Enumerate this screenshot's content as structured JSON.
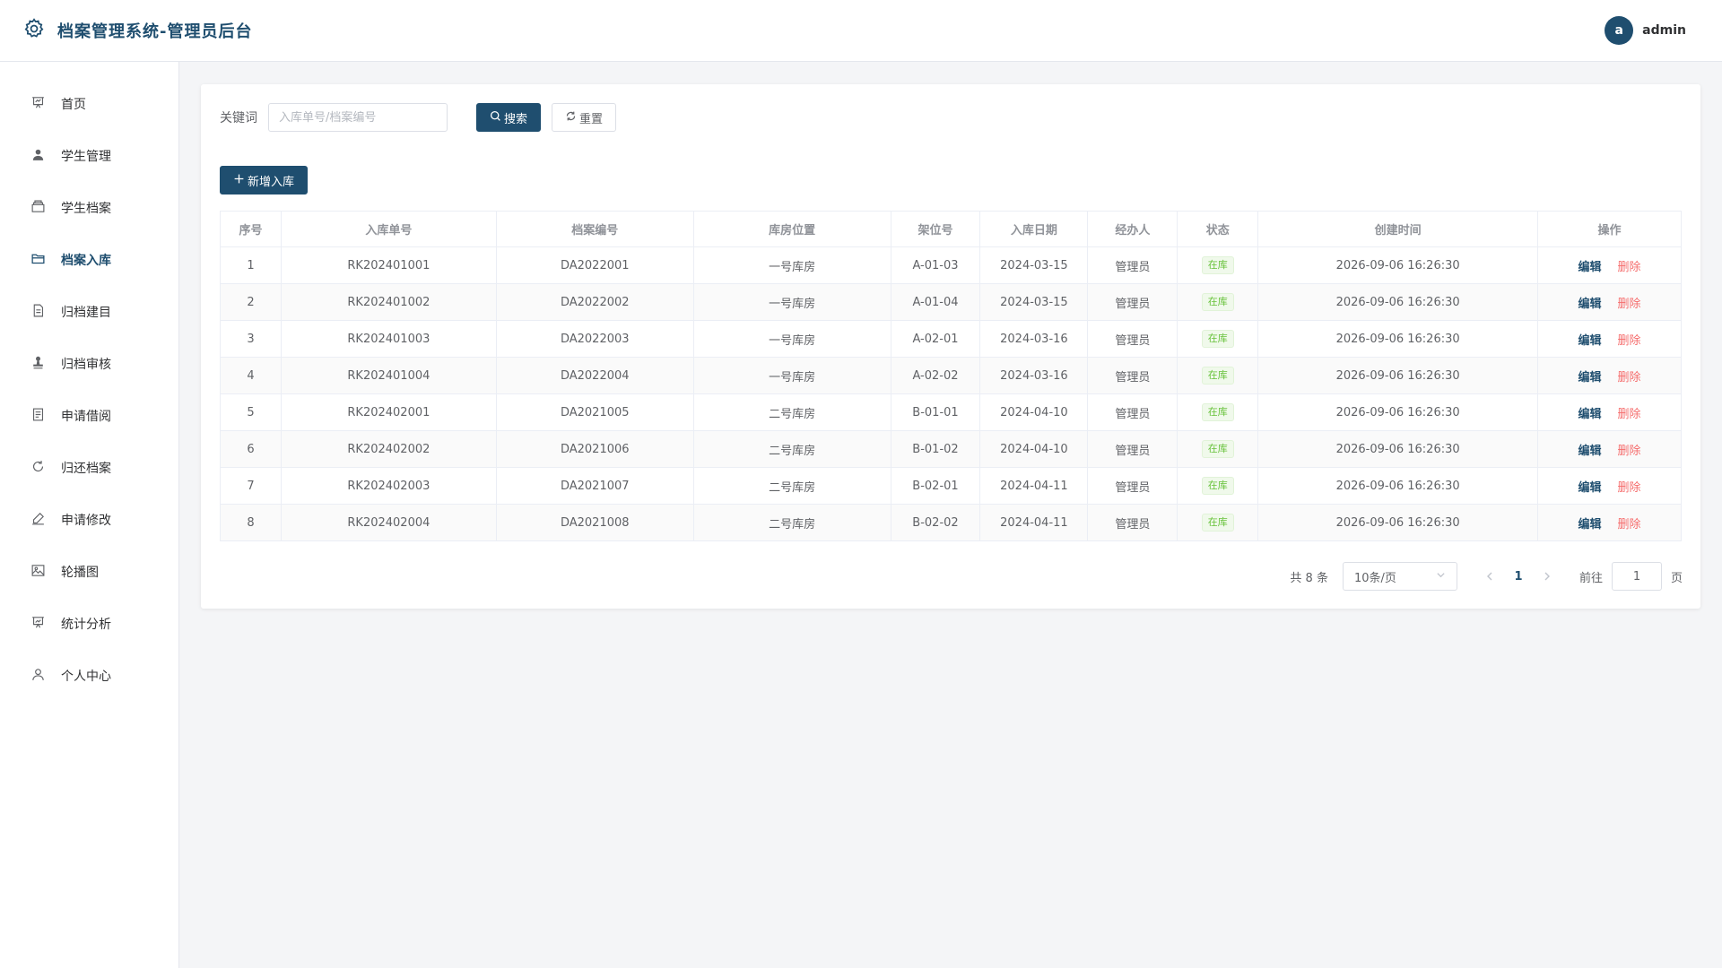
{
  "header": {
    "title": "档案管理系统-管理员后台",
    "logo_icon": "gear-icon",
    "avatar_letter": "a",
    "username": "admin"
  },
  "sidebar": {
    "items": [
      {
        "label": "首页",
        "icon": "presentation-icon",
        "active": false
      },
      {
        "label": "学生管理",
        "icon": "user-icon",
        "active": false
      },
      {
        "label": "学生档案",
        "icon": "box-icon",
        "active": false
      },
      {
        "label": "档案入库",
        "icon": "folder-icon",
        "active": true
      },
      {
        "label": "归档建目",
        "icon": "document-icon",
        "active": false
      },
      {
        "label": "归档审核",
        "icon": "stamp-icon",
        "active": false
      },
      {
        "label": "申请借阅",
        "icon": "tickets-icon",
        "active": false
      },
      {
        "label": "归还档案",
        "icon": "refresh-icon",
        "active": false
      },
      {
        "label": "申请修改",
        "icon": "edit-pen-icon",
        "active": false
      },
      {
        "label": "轮播图",
        "icon": "picture-icon",
        "active": false
      },
      {
        "label": "统计分析",
        "icon": "data-board-icon",
        "active": false
      },
      {
        "label": "个人中心",
        "icon": "user-outline-icon",
        "active": false
      }
    ]
  },
  "search": {
    "label": "关键词",
    "placeholder": "入库单号/档案编号",
    "value": "",
    "search_btn": "搜索",
    "reset_btn": "重置"
  },
  "toolbar": {
    "add_btn": "新增入库"
  },
  "table": {
    "columns": [
      "序号",
      "入库单号",
      "档案编号",
      "库房位置",
      "架位号",
      "入库日期",
      "经办人",
      "状态",
      "创建时间",
      "操作"
    ],
    "edit_label": "编辑",
    "delete_label": "删除",
    "rows": [
      {
        "index": "1",
        "inbound_no": "RK202401001",
        "archive_no": "DA2022001",
        "location": "一号库房",
        "shelf": "A-01-03",
        "date": "2024-03-15",
        "handler": "管理员",
        "status": "在库",
        "created": "2026-09-06 16:26:30"
      },
      {
        "index": "2",
        "inbound_no": "RK202401002",
        "archive_no": "DA2022002",
        "location": "一号库房",
        "shelf": "A-01-04",
        "date": "2024-03-15",
        "handler": "管理员",
        "status": "在库",
        "created": "2026-09-06 16:26:30"
      },
      {
        "index": "3",
        "inbound_no": "RK202401003",
        "archive_no": "DA2022003",
        "location": "一号库房",
        "shelf": "A-02-01",
        "date": "2024-03-16",
        "handler": "管理员",
        "status": "在库",
        "created": "2026-09-06 16:26:30"
      },
      {
        "index": "4",
        "inbound_no": "RK202401004",
        "archive_no": "DA2022004",
        "location": "一号库房",
        "shelf": "A-02-02",
        "date": "2024-03-16",
        "handler": "管理员",
        "status": "在库",
        "created": "2026-09-06 16:26:30"
      },
      {
        "index": "5",
        "inbound_no": "RK202402001",
        "archive_no": "DA2021005",
        "location": "二号库房",
        "shelf": "B-01-01",
        "date": "2024-04-10",
        "handler": "管理员",
        "status": "在库",
        "created": "2026-09-06 16:26:30"
      },
      {
        "index": "6",
        "inbound_no": "RK202402002",
        "archive_no": "DA2021006",
        "location": "二号库房",
        "shelf": "B-01-02",
        "date": "2024-04-10",
        "handler": "管理员",
        "status": "在库",
        "created": "2026-09-06 16:26:30"
      },
      {
        "index": "7",
        "inbound_no": "RK202402003",
        "archive_no": "DA2021007",
        "location": "二号库房",
        "shelf": "B-02-01",
        "date": "2024-04-11",
        "handler": "管理员",
        "status": "在库",
        "created": "2026-09-06 16:26:30"
      },
      {
        "index": "8",
        "inbound_no": "RK202402004",
        "archive_no": "DA2021008",
        "location": "二号库房",
        "shelf": "B-02-02",
        "date": "2024-04-11",
        "handler": "管理员",
        "status": "在库",
        "created": "2026-09-06 16:26:30"
      }
    ]
  },
  "pagination": {
    "total_text": "共 8 条",
    "page_size": "10条/页",
    "current_page": "1",
    "goto_label": "前往",
    "goto_value": "1",
    "page_unit": "页"
  },
  "colors": {
    "primary": "#1f4e6f",
    "danger": "#f56c6c",
    "success": "#67c23a"
  }
}
